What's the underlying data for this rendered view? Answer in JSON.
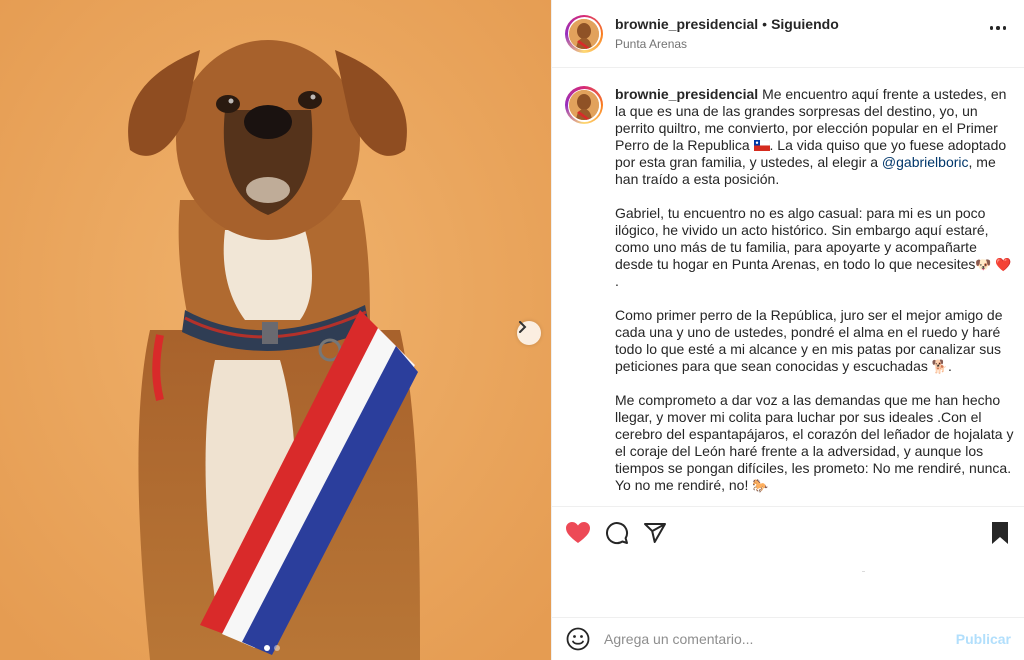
{
  "post": {
    "image_alt": "Perro con banda presidencial",
    "carousel": {
      "total": 2,
      "active": 0
    }
  },
  "header": {
    "username": "brownie_presidencial",
    "separator": "•",
    "follow_status": "Siguiendo",
    "location": "Punta Arenas"
  },
  "caption": {
    "username": "brownie_presidencial",
    "p1_a": "Me encuentro aquí frente a ustedes, en la que es una de las grandes sorpresas del destino, yo, un perrito quiltro, me convierto, por elección popular en el Primer Perro de la Republica",
    "p1_b": ". La vida quiso que yo fuese adoptado por esta gran familia, y ustedes, al elegir a",
    "mention": "@gabrielboric",
    "p1_c": ", me han traído a esta posición.",
    "p2": "Gabriel, tu encuentro no es algo casual: para mi es un poco ilógico, he vivido un acto histórico. Sin embargo aquí estaré, como uno más de tu familia, para apoyarte y acompañarte desde tu hogar en Punta Arenas, en todo lo que necesites",
    "p2_emoji": "🐶 ❤️",
    "p2_end": ".",
    "p3": "Como primer perro de la República, juro ser el mejor amigo de cada una y uno de ustedes, pondré el alma en el ruedo y haré todo lo que esté a mi alcance y en mis patas por canalizar sus peticiones para que sean conocidas y escuchadas",
    "p3_emoji": "🐕",
    "p3_end": ".",
    "p4": "Me comprometo a dar voz a las demandas que me han hecho llegar, y mover mi colita para luchar por sus ideales .Con el cerebro del espantapájaros, el corazón del leñador de hojalata y el coraje del León haré frente a la adversidad, y aunque los tiempos se pongan difíciles, les prometo: No me rendiré, nunca. Yo no me rendiré, no!",
    "p4_emoji": "🐎"
  },
  "comment": {
    "placeholder": "Agrega un comentario...",
    "publish_label": "Publicar"
  },
  "colors": {
    "like_red": "#ed4956",
    "publish_blue": "#b2dffc",
    "photo_bg": "#e9a55e"
  },
  "icons": [
    "heart-icon",
    "comment-icon",
    "share-icon",
    "bookmark-icon",
    "emoji-icon",
    "more-icon",
    "chevron-right-icon"
  ]
}
